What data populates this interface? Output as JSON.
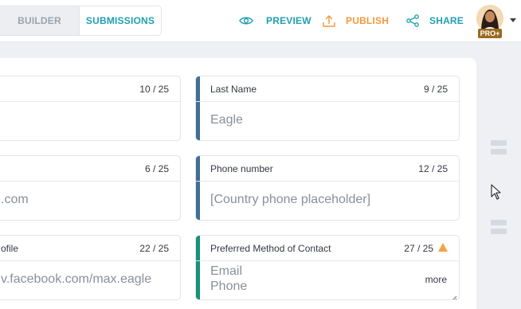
{
  "header": {
    "tabs": [
      {
        "label": "BUILDER"
      },
      {
        "label": "SUBMISSIONS"
      }
    ],
    "actions": {
      "preview": "PREVIEW",
      "publish": "PUBLISH",
      "share": "SHARE"
    },
    "user": {
      "badge": "PRO+"
    }
  },
  "fields": {
    "first_name": {
      "count": "10 / 25"
    },
    "last_name": {
      "label": "Last Name",
      "count": "9 / 25",
      "value": "Eagle"
    },
    "email": {
      "count": "6 / 25",
      "value": ".com"
    },
    "phone": {
      "label": "Phone number",
      "count": "12 / 25",
      "value": "[Country phone placeholder]"
    },
    "profile": {
      "label": "ofile",
      "count": "22 / 25",
      "value": "v.facebook.com/max.eagle"
    },
    "contact": {
      "label": "Preferred Method of Contact",
      "count": "27 / 25",
      "option1": "Email",
      "option2": "Phone",
      "more": "more"
    }
  },
  "colors": {
    "accent_teal": "#1f9fb3",
    "accent_orange": "#ef9a3e",
    "field_bar_blue": "#3f6e96",
    "field_bar_green": "#17917a",
    "warning": "#f2a344"
  },
  "icons": [
    "eye-icon",
    "upload-icon",
    "share-icon",
    "warning-icon",
    "drag-handle-icon",
    "cursor-icon"
  ]
}
